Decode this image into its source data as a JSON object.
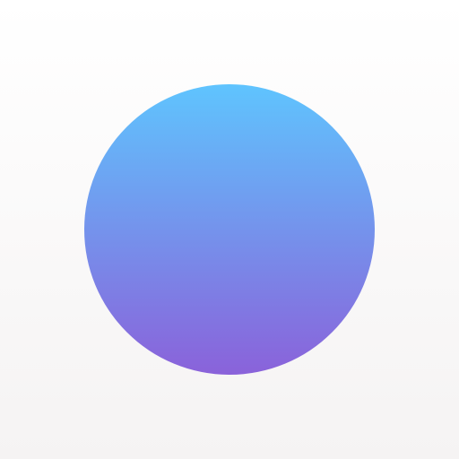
{
  "background": {
    "color_top": "#ffffff",
    "color_bottom": "#f5f3f3"
  },
  "circle": {
    "icon": "gradient-circle-icon",
    "color_top": "#5fc4fe",
    "color_bottom": "#8a62da"
  }
}
